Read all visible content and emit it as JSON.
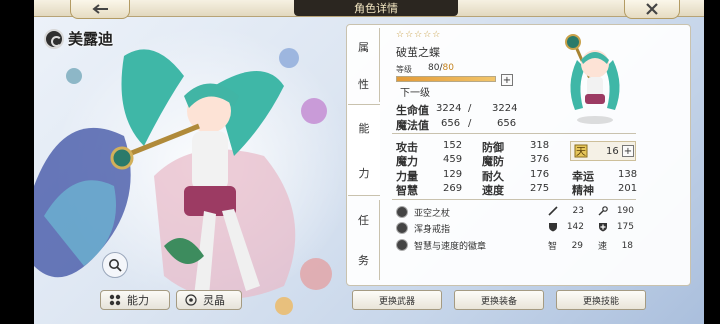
{
  "header": {
    "title": "角色详情"
  },
  "character": {
    "name": "美露迪",
    "stars": "☆☆☆☆☆",
    "epithet": "破茧之蝶",
    "level_label": "等级",
    "level_current": "80",
    "level_sep": "/",
    "level_max": "80",
    "level_progress": 1.0,
    "next_level_label": "下一级"
  },
  "tabs": [
    {
      "chars": [
        "属",
        "性"
      ]
    },
    {
      "chars": [
        "能",
        "力"
      ]
    },
    {
      "chars": [
        "任",
        "务"
      ]
    }
  ],
  "stats": {
    "hp": {
      "label": "生命值",
      "cur": "3224",
      "sep": "/",
      "max": "3224"
    },
    "mp": {
      "label": "魔法值",
      "cur": "656",
      "sep": "/",
      "max": "656"
    },
    "attack": {
      "label": "攻击",
      "value": "152"
    },
    "defense": {
      "label": "防御",
      "value": "318"
    },
    "magic": {
      "label": "魔力",
      "value": "459"
    },
    "mdef": {
      "label": "魔防",
      "value": "376"
    },
    "strength": {
      "label": "力量",
      "value": "129"
    },
    "endurance": {
      "label": "耐久",
      "value": "176"
    },
    "luck": {
      "label": "幸运",
      "value": "138"
    },
    "wisdom": {
      "label": "智慧",
      "value": "269"
    },
    "speed": {
      "label": "速度",
      "value": "275"
    },
    "spirit": {
      "label": "精神",
      "value": "201"
    },
    "points": {
      "value": "16"
    }
  },
  "equipment": [
    {
      "name": "亚空之杖",
      "s1": "23",
      "s2": "190"
    },
    {
      "name": "浑身戒指",
      "s1": "142",
      "s2": "175"
    },
    {
      "name": "智慧与速度的徽章",
      "l1": "智",
      "s1": "29",
      "l2": "速",
      "s2": "18"
    }
  ],
  "buttons": {
    "ability": "能力",
    "spirit_crystal": "灵晶",
    "change_weapon": "更换武器",
    "change_equipment": "更换装备",
    "change_skill": "更换技能"
  },
  "colors": {
    "accent_gold": "#c9a24b",
    "level_max": "#c4821d",
    "dark_tab": "#2b2620"
  }
}
